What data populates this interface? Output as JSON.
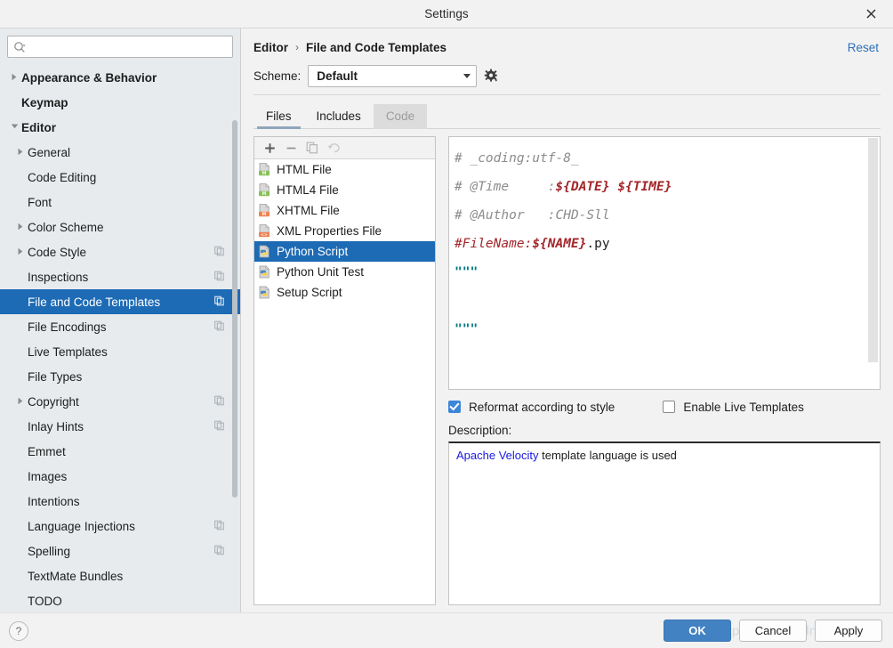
{
  "window": {
    "title": "Settings",
    "close_icon": "close-icon"
  },
  "sidebar": {
    "search": {
      "placeholder": "",
      "value": "",
      "icon": "search-icon"
    },
    "items": [
      {
        "label": "Appearance & Behavior",
        "level": 0,
        "arrow": "collapsed",
        "bold": true,
        "selected": false,
        "copy": false
      },
      {
        "label": "Keymap",
        "level": 0,
        "arrow": "none",
        "bold": true,
        "selected": false,
        "copy": false
      },
      {
        "label": "Editor",
        "level": 0,
        "arrow": "expanded",
        "bold": true,
        "selected": false,
        "copy": false
      },
      {
        "label": "General",
        "level": 1,
        "arrow": "collapsed",
        "bold": false,
        "selected": false,
        "copy": false
      },
      {
        "label": "Code Editing",
        "level": 1,
        "arrow": "none",
        "bold": false,
        "selected": false,
        "copy": false
      },
      {
        "label": "Font",
        "level": 1,
        "arrow": "none",
        "bold": false,
        "selected": false,
        "copy": false
      },
      {
        "label": "Color Scheme",
        "level": 1,
        "arrow": "collapsed",
        "bold": false,
        "selected": false,
        "copy": false
      },
      {
        "label": "Code Style",
        "level": 1,
        "arrow": "collapsed",
        "bold": false,
        "selected": false,
        "copy": true
      },
      {
        "label": "Inspections",
        "level": 1,
        "arrow": "none",
        "bold": false,
        "selected": false,
        "copy": true
      },
      {
        "label": "File and Code Templates",
        "level": 1,
        "arrow": "none",
        "bold": false,
        "selected": true,
        "copy": true
      },
      {
        "label": "File Encodings",
        "level": 1,
        "arrow": "none",
        "bold": false,
        "selected": false,
        "copy": true
      },
      {
        "label": "Live Templates",
        "level": 1,
        "arrow": "none",
        "bold": false,
        "selected": false,
        "copy": false
      },
      {
        "label": "File Types",
        "level": 1,
        "arrow": "none",
        "bold": false,
        "selected": false,
        "copy": false
      },
      {
        "label": "Copyright",
        "level": 1,
        "arrow": "collapsed",
        "bold": false,
        "selected": false,
        "copy": true
      },
      {
        "label": "Inlay Hints",
        "level": 1,
        "arrow": "none",
        "bold": false,
        "selected": false,
        "copy": true
      },
      {
        "label": "Emmet",
        "level": 1,
        "arrow": "none",
        "bold": false,
        "selected": false,
        "copy": false
      },
      {
        "label": "Images",
        "level": 1,
        "arrow": "none",
        "bold": false,
        "selected": false,
        "copy": false
      },
      {
        "label": "Intentions",
        "level": 1,
        "arrow": "none",
        "bold": false,
        "selected": false,
        "copy": false
      },
      {
        "label": "Language Injections",
        "level": 1,
        "arrow": "none",
        "bold": false,
        "selected": false,
        "copy": true
      },
      {
        "label": "Spelling",
        "level": 1,
        "arrow": "none",
        "bold": false,
        "selected": false,
        "copy": true
      },
      {
        "label": "TextMate Bundles",
        "level": 1,
        "arrow": "none",
        "bold": false,
        "selected": false,
        "copy": false
      },
      {
        "label": "TODO",
        "level": 1,
        "arrow": "none",
        "bold": false,
        "selected": false,
        "copy": false
      }
    ]
  },
  "header": {
    "breadcrumb": [
      "Editor",
      "File and Code Templates"
    ],
    "separator": "›",
    "reset_label": "Reset",
    "scheme_label": "Scheme:",
    "scheme_value": "Default",
    "gear_icon": "gear-icon"
  },
  "tabs": [
    {
      "label": "Files",
      "state": "active"
    },
    {
      "label": "Includes",
      "state": "normal"
    },
    {
      "label": "Code",
      "state": "disabled"
    }
  ],
  "template_list": {
    "toolbar": [
      {
        "name": "add-template-button",
        "glyph": "+",
        "enabled": true
      },
      {
        "name": "remove-template-button",
        "glyph": "−",
        "enabled": true
      },
      {
        "name": "copy-template-button",
        "glyph": "copy-icon",
        "enabled": false
      },
      {
        "name": "reset-template-button",
        "glyph": "undo-icon",
        "enabled": false
      }
    ],
    "items": [
      {
        "label": "HTML File",
        "icon": "html-file-icon",
        "badge": "H",
        "badge_color": "#89c05a",
        "selected": false
      },
      {
        "label": "HTML4 File",
        "icon": "html-file-icon",
        "badge": "H",
        "badge_color": "#89c05a",
        "selected": false
      },
      {
        "label": "XHTML File",
        "icon": "xhtml-file-icon",
        "badge": "H",
        "badge_color": "#ef8354",
        "selected": false
      },
      {
        "label": "XML Properties File",
        "icon": "xml-file-icon",
        "badge": "<>",
        "badge_color": "#ef8354",
        "selected": false
      },
      {
        "label": "Python Script",
        "icon": "python-file-icon",
        "badge": "",
        "badge_color": "#ffd43b",
        "selected": true
      },
      {
        "label": "Python Unit Test",
        "icon": "python-file-icon",
        "badge": "",
        "badge_color": "#ffd43b",
        "selected": false
      },
      {
        "label": "Setup Script",
        "icon": "python-file-icon",
        "badge": "",
        "badge_color": "#ffd43b",
        "selected": false
      }
    ]
  },
  "code_editor": {
    "lines": [
      {
        "parts": [
          {
            "text": "# _coding:utf-8_",
            "style": "comment"
          }
        ]
      },
      {
        "parts": [
          {
            "text": "# @Time     :",
            "style": "comment"
          },
          {
            "text": "${DATE} ${TIME}",
            "style": "var"
          }
        ]
      },
      {
        "parts": [
          {
            "text": "# @Author   :CHD-Sll",
            "style": "comment"
          }
        ]
      },
      {
        "parts": [
          {
            "text": "#FileName:",
            "style": "red"
          },
          {
            "text": "${NAME}",
            "style": "var"
          },
          {
            "text": ".py",
            "style": "plain"
          }
        ]
      },
      {
        "parts": [
          {
            "text": "\"\"\"",
            "style": "string"
          }
        ]
      },
      {
        "parts": [
          {
            "text": "",
            "style": "plain"
          }
        ]
      },
      {
        "parts": [
          {
            "text": "\"\"\"",
            "style": "string"
          }
        ]
      }
    ]
  },
  "options": {
    "reformat": {
      "label": "Reformat according to style",
      "checked": true
    },
    "live_templates": {
      "label": "Enable Live Templates",
      "checked": false
    }
  },
  "description": {
    "label": "Description:",
    "link_text": "Apache Velocity",
    "rest_text": " template language is used"
  },
  "footer": {
    "help_glyph": "?",
    "watermark": "https://blog.csdn.net/bz_ffff",
    "buttons": [
      {
        "label": "OK",
        "primary": true
      },
      {
        "label": "Cancel",
        "primary": false
      },
      {
        "label": "Apply",
        "primary": false
      }
    ]
  },
  "colors": {
    "accent_selection": "#1d6ab5",
    "primary_button": "#4282c3",
    "link": "#2f6fb5",
    "sidebar_bg": "#e7ebee",
    "panel_bg": "#f2f2f2"
  }
}
